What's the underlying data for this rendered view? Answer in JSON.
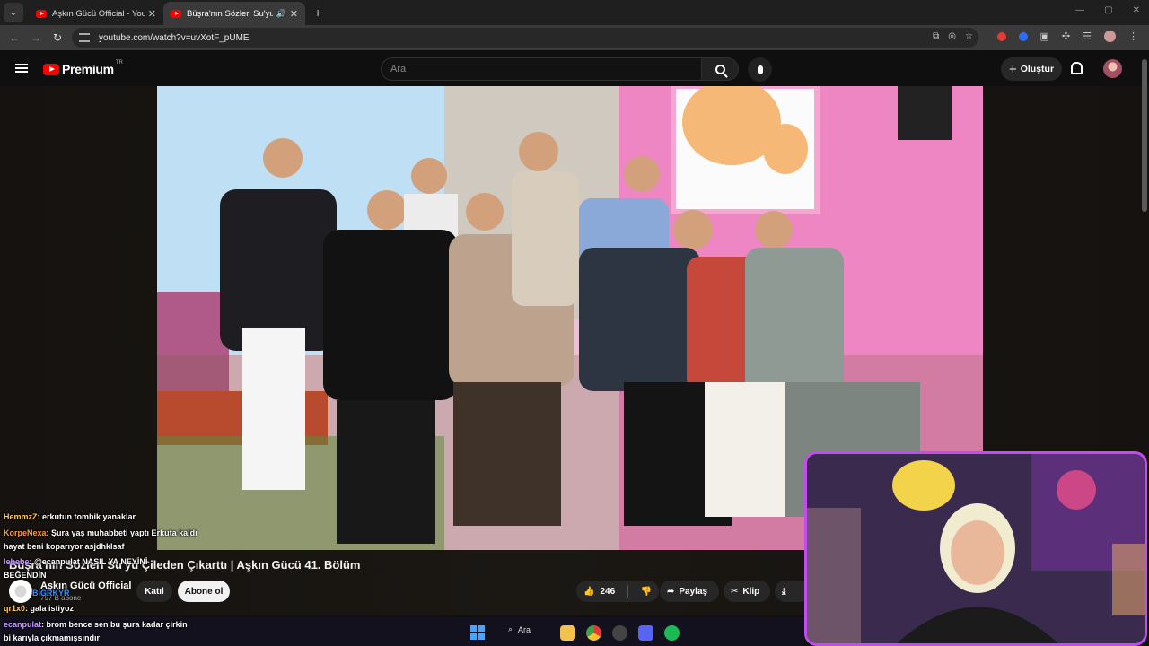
{
  "browser": {
    "tabs": [
      {
        "title": "Aşkın Gücü Official - YouTube",
        "active": false
      },
      {
        "title": "Büşra'nın Sözleri Su'yu Çileden",
        "active": true
      }
    ],
    "url": "youtube.com/watch?v=uvXotF_pUME"
  },
  "youtube": {
    "logo_text": "Premium",
    "logo_region": "TR",
    "search_placeholder": "Ara",
    "create_label": "Oluştur"
  },
  "video": {
    "title": "Büşra'nın Sözleri Su'yu Çileden Çıkarttı | Aşkın Gücü 41. Bölüm",
    "channel": "Aşkın Gücü Official",
    "subscribers": "797 B abone",
    "join_label": "Katıl",
    "subscribe_label": "Abone ol",
    "likes": "246",
    "share_label": "Paylaş",
    "clip_label": "Klip"
  },
  "chat": [
    {
      "user": "HemmzZ",
      "text": ": erkutun tombik yanaklar"
    },
    {
      "user": "KorpeNexa",
      "text": ": Şura yaş muhabbeti yaptı Erkuta kaldı"
    },
    {
      "user": "",
      "text": "hayat beni koparıyor asjdhklsaf"
    },
    {
      "user": "lebebe",
      "text": ": @ecanpulat NASIL YA NEYİNİ"
    },
    {
      "user": "",
      "text": "BEĞENDİN"
    },
    {
      "user": "BiGRKYR",
      "text": ""
    },
    {
      "user": "qr1x0",
      "text": ": gala istiyoz"
    },
    {
      "user": "ecanpulat",
      "text": ": brom bence sen bu şura kadar çirkin"
    },
    {
      "user": "",
      "text": "bi karıyla çıkmamışsındır"
    }
  ],
  "taskbar": {
    "search_label": "Ara"
  },
  "colors": {
    "accent_red": "#ff0000",
    "webcam_border": "#c34cf0",
    "chat_gold": "#ffcc55",
    "chat_orange": "#ff9e3d",
    "chat_purple": "#c59cff"
  }
}
